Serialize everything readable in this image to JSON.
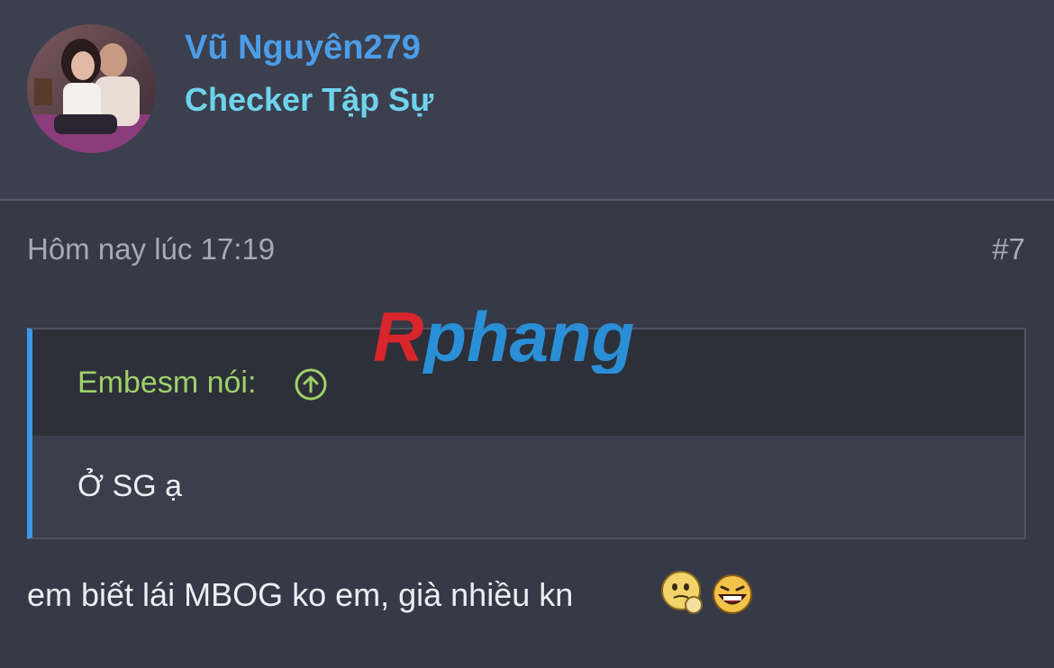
{
  "user": {
    "name": "Vũ Nguyên279",
    "title": "Checker Tập Sự"
  },
  "post": {
    "time": "Hôm nay lúc 17:19",
    "number": "#7",
    "body": "em biết lái MBOG ko em, già nhiều kn"
  },
  "quote": {
    "author": "Embesm nói:",
    "text": "Ở SG ạ"
  },
  "watermark": {
    "text": "Rphang"
  },
  "icons": [
    "avatar-photo",
    "arrow-up-circle-icon",
    "thinking-smiley-icon",
    "laughing-smiley-icon"
  ],
  "colors": {
    "username": "#4c9de8",
    "user_title": "#6fd3ec",
    "quote_author": "#9fd06a",
    "quote_border": "#3f97e8",
    "background": "#363a47"
  }
}
